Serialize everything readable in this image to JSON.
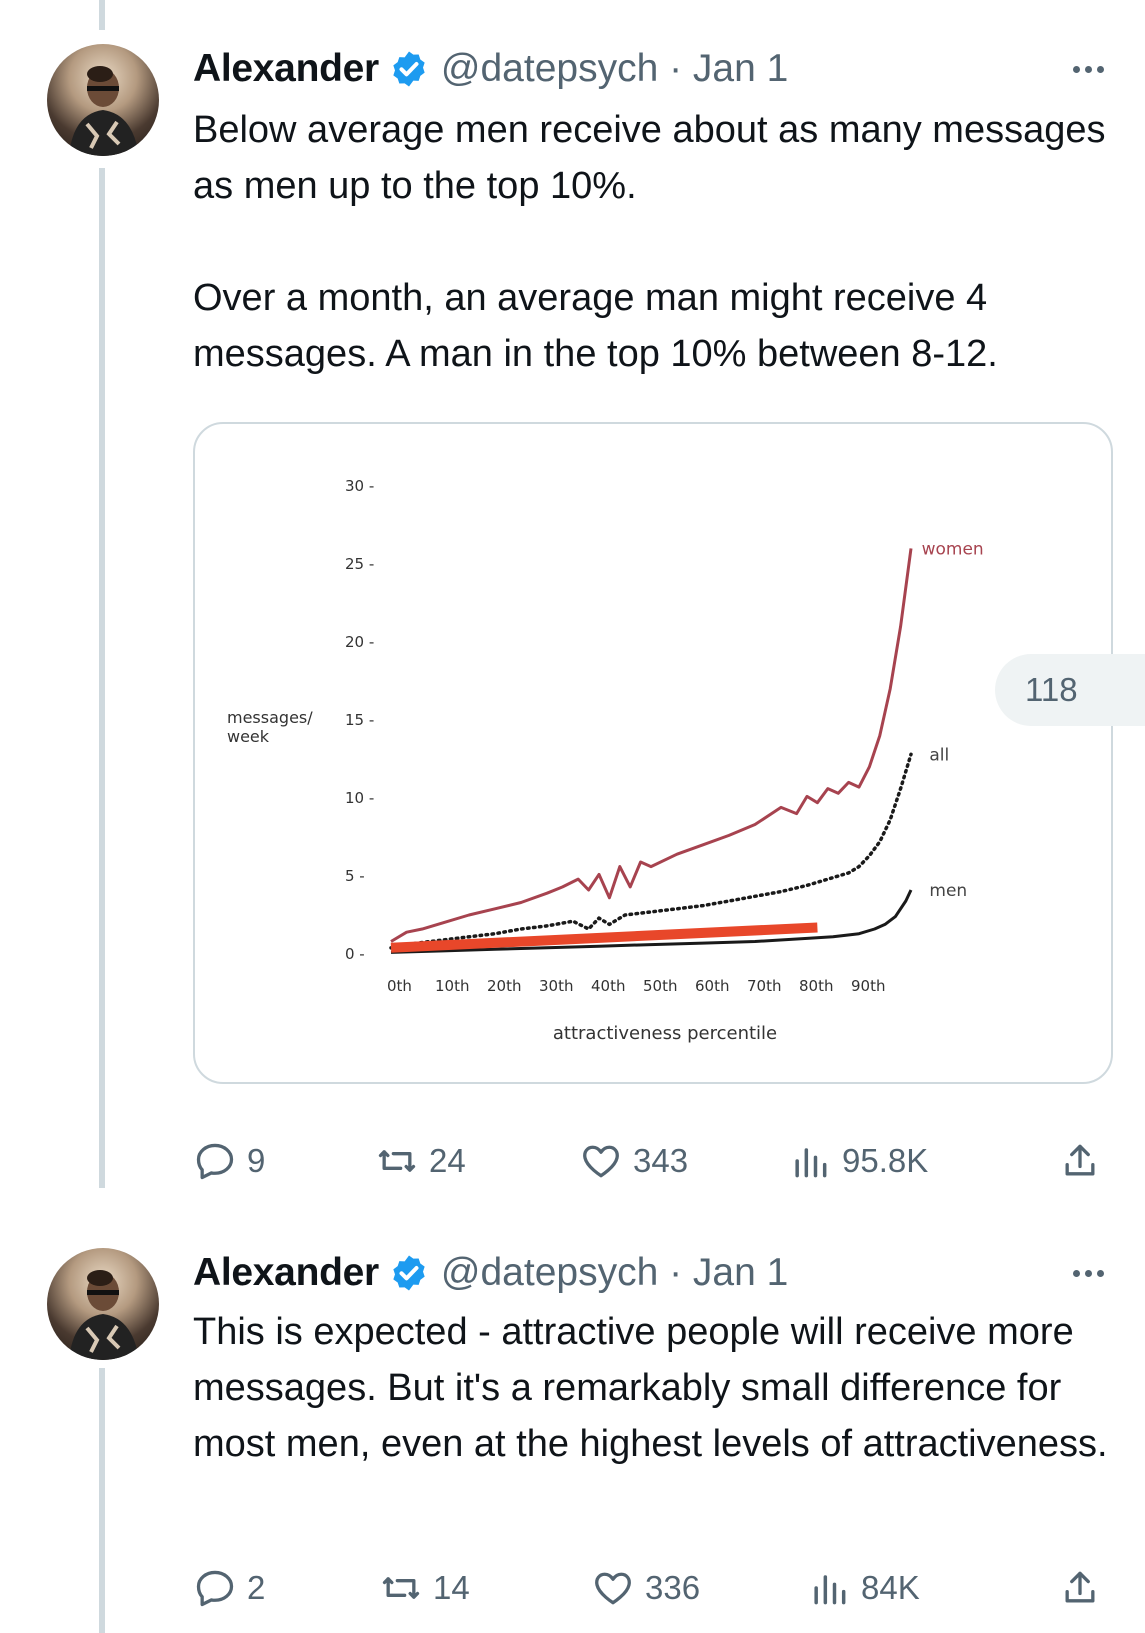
{
  "colors": {
    "text": "#0f1419",
    "secondary": "#536471",
    "verified": "#1d9bf0",
    "women_line": "#a7434f",
    "men_line": "#1a1a1a",
    "highlight": "#e8472a"
  },
  "tweets": [
    {
      "author": "Alexander",
      "handle": "@datepsych · Jan 1",
      "paragraphs": [
        "Below average men receive about as many messages as men up to the top 10%.",
        "Over a month, an average man might receive 4 messages. A man in the top 10% between 8-12."
      ],
      "stats": {
        "replies": "9",
        "reposts": "24",
        "likes": "343",
        "views": "95.8K"
      }
    },
    {
      "author": "Alexander",
      "handle": "@datepsych · Jan 1",
      "paragraphs": [
        "This is expected - attractive people will receive more messages. But it's a remarkably small difference for most men, even at the highest levels of attractiveness."
      ],
      "stats": {
        "replies": "2",
        "reposts": "14",
        "likes": "336",
        "views": "84K"
      }
    }
  ],
  "overlay_count": "118",
  "chart_data": {
    "type": "line",
    "xlabel": "attractiveness percentile",
    "ylabel": "messages/ week",
    "x_ticks": [
      "0th",
      "10th",
      "20th",
      "30th",
      "40th",
      "50th",
      "60th",
      "70th",
      "80th",
      "90th"
    ],
    "y_ticks": [
      "0 -",
      "5 -",
      "10 -",
      "15 -",
      "20 -",
      "25 -",
      "30 -"
    ],
    "xlim": [
      0,
      100
    ],
    "ylim": [
      0,
      30
    ],
    "series": [
      {
        "name": "women",
        "color": "#a7434f",
        "style": "solid",
        "x": [
          0,
          3,
          6,
          10,
          15,
          20,
          25,
          30,
          33,
          36,
          38,
          40,
          42,
          44,
          46,
          48,
          50,
          55,
          60,
          65,
          70,
          75,
          78,
          80,
          82,
          84,
          86,
          88,
          90,
          92,
          94,
          96,
          98,
          100
        ],
        "y": [
          0.8,
          1.4,
          1.6,
          2.0,
          2.5,
          2.9,
          3.3,
          3.9,
          4.3,
          4.8,
          4.1,
          5.1,
          3.6,
          5.6,
          4.3,
          5.9,
          5.6,
          6.4,
          7.0,
          7.6,
          8.3,
          9.4,
          9.0,
          10.1,
          9.7,
          10.6,
          10.3,
          11.0,
          10.7,
          12.0,
          14.0,
          17.0,
          21.0,
          26.0
        ]
      },
      {
        "name": "all",
        "color": "#1a1a1a",
        "style": "dotted",
        "x": [
          0,
          5,
          10,
          15,
          20,
          25,
          30,
          35,
          38,
          40,
          42,
          45,
          50,
          55,
          60,
          65,
          70,
          75,
          80,
          85,
          88,
          90,
          92,
          94,
          96,
          98,
          100
        ],
        "y": [
          0.4,
          0.7,
          0.9,
          1.1,
          1.3,
          1.6,
          1.8,
          2.1,
          1.6,
          2.3,
          1.9,
          2.5,
          2.7,
          2.9,
          3.1,
          3.4,
          3.7,
          4.0,
          4.4,
          4.9,
          5.2,
          5.6,
          6.3,
          7.2,
          8.6,
          10.6,
          12.8
        ]
      },
      {
        "name": "men",
        "color": "#1a1a1a",
        "style": "solid",
        "x": [
          0,
          10,
          20,
          30,
          40,
          50,
          60,
          70,
          80,
          85,
          90,
          93,
          95,
          97,
          99,
          100
        ],
        "y": [
          0.1,
          0.2,
          0.3,
          0.4,
          0.5,
          0.6,
          0.7,
          0.8,
          1.0,
          1.1,
          1.3,
          1.6,
          1.9,
          2.4,
          3.4,
          4.1
        ]
      }
    ],
    "annotations": [
      {
        "type": "highlight_bar",
        "color": "#e8472a",
        "x": [
          0,
          82
        ],
        "y": [
          0.4,
          1.7
        ]
      }
    ]
  }
}
